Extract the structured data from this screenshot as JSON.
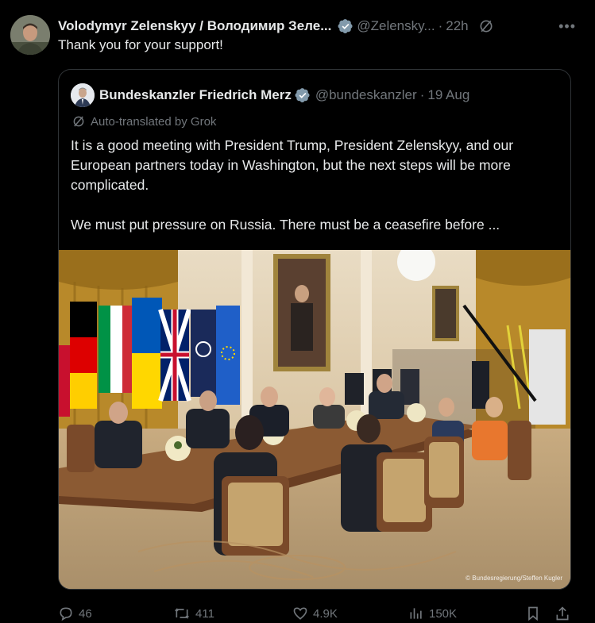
{
  "author": {
    "name": "Volodymyr Zelenskyy / Володимир Зеле...",
    "handle": "@Zelensky...",
    "separator": "·",
    "time": "22h",
    "avatar_icon": "avatar-zelenskyy",
    "verified_color": "#829aab"
  },
  "tweet": {
    "text": "Thank you for your support!"
  },
  "quote": {
    "name": "Bundeskanzler Friedrich Merz",
    "handle": "@bundeskanzler",
    "separator": "·",
    "date": "19 Aug",
    "verified_color": "#829aab",
    "translation_note": "Auto-translated by Grok",
    "paragraphs": [
      "It is a good meeting with President Trump, President Zelenskyy, and our European partners today in Washington, but the next steps will be more complicated.",
      "We must put pressure on Russia. There must be a ceasefire before ..."
    ],
    "photo_credit": "© Bundesregierung/Steffen Kugler"
  },
  "actions": {
    "replies": "46",
    "reposts": "411",
    "likes": "4.9K",
    "views": "150K"
  }
}
